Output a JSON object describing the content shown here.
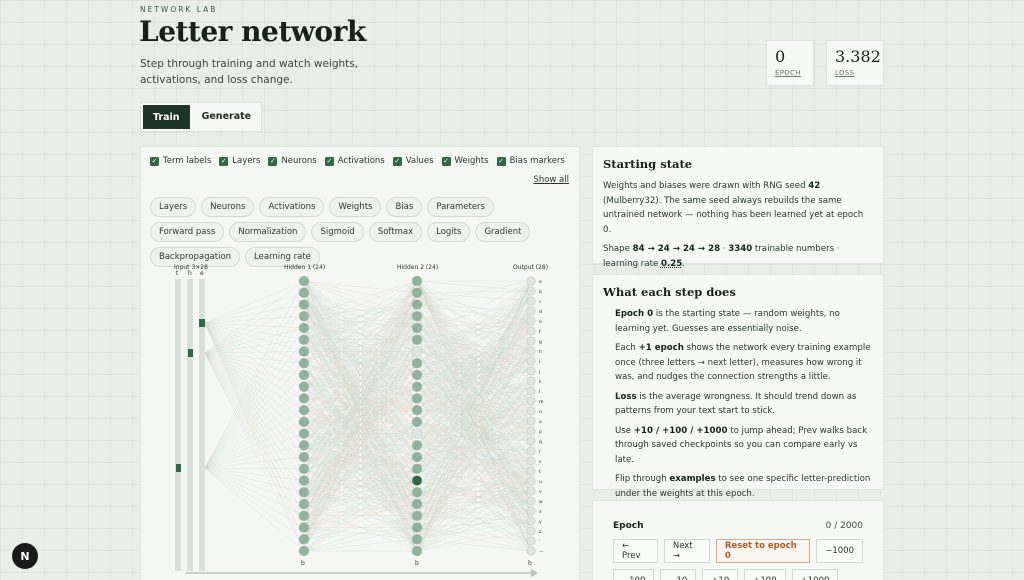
{
  "header": {
    "eyebrow": "NETWORK LAB",
    "title": "Letter network",
    "subtitle": "Step through training and watch weights, activations, and loss change."
  },
  "stats": {
    "epoch_value": "0",
    "epoch_label": "EPOCH",
    "loss_value": "3.382",
    "loss_label": "LOSS"
  },
  "tabs": [
    {
      "label": "Train",
      "active": true
    },
    {
      "label": "Generate",
      "active": false
    }
  ],
  "toggles": [
    {
      "label": "Term labels",
      "checked": true
    },
    {
      "label": "Layers",
      "checked": true
    },
    {
      "label": "Neurons",
      "checked": true
    },
    {
      "label": "Activations",
      "checked": true
    },
    {
      "label": "Values",
      "checked": true
    },
    {
      "label": "Weights",
      "checked": true
    },
    {
      "label": "Bias markers",
      "checked": true
    }
  ],
  "show_all_label": "Show all",
  "terms": [
    "Layers",
    "Neurons",
    "Activations",
    "Weights",
    "Bias",
    "Parameters",
    "Forward pass",
    "Normalization",
    "Sigmoid",
    "Softmax",
    "Logits",
    "Gradient",
    "Backpropagation",
    "Learning rate"
  ],
  "network": {
    "input_label": "Input 3×28",
    "input_letters": [
      "t",
      "h",
      "e"
    ],
    "hidden1_label": "Hidden 1 (24)",
    "hidden2_label": "Hidden 2 (24)",
    "output_label": "Output (28)",
    "output_letters": [
      "a",
      "b",
      "c",
      "d",
      "e",
      "f",
      "g",
      "h",
      "i",
      "j",
      "k",
      "l",
      "m",
      "n",
      "o",
      "p",
      "q",
      "r",
      "s",
      "t",
      "u",
      "v",
      "w",
      "x",
      "y",
      "z",
      "'",
      "—"
    ],
    "bias_glyph": "b",
    "colors": {
      "node": "#8fb39b",
      "active": "#2f6a46",
      "weight_pos": "#bcd2c2",
      "weight_neg": "#e6c6b2"
    }
  },
  "seed_card": {
    "title": "Starting state",
    "p1_a": "Weights and biases were drawn with RNG seed ",
    "p1_seed": "42",
    "p1_b": " (Mulberry32). The same seed always rebuilds the same untrained network — nothing has been learned yet at epoch 0.",
    "p2_a": "Shape ",
    "p2_shape": "84 → 24 → 24 → 28",
    "p2_sep": " · ",
    "p2_count": "3340",
    "p2_b": " trainable numbers · learning rate ",
    "p2_lr": "0.25",
    "p2_end": "."
  },
  "steps_card": {
    "title": "What each step does",
    "s1_b": "Epoch 0",
    "s1": " is the starting state — random weights, no learning yet. Guesses are essentially noise.",
    "s2_a": "Each ",
    "s2_b": "+1 epoch",
    "s2": " shows the network every training example once (three letters → next letter), measures how wrong it was, and nudges the connection strengths a little.",
    "s3_b": "Loss",
    "s3": " is the average wrongness. It should trend down as patterns from your text start to stick.",
    "s4_a": "Use ",
    "s4_b": "+10 / +100 / +1000",
    "s4": " to jump ahead; Prev walks back through saved checkpoints so you can compare early vs late.",
    "s5_a": "Flip through ",
    "s5_b": "examples",
    "s5": " to see one specific letter-prediction under the weights at this epoch."
  },
  "epoch_card": {
    "label": "Epoch",
    "count": "0 / 2000",
    "prev": "← Prev",
    "next": "Next →",
    "reset": "Reset to epoch 0",
    "minus1000": "−1000",
    "row2": [
      "−100",
      "−10",
      "+10",
      "+100",
      "+1000"
    ]
  },
  "badge": "N"
}
